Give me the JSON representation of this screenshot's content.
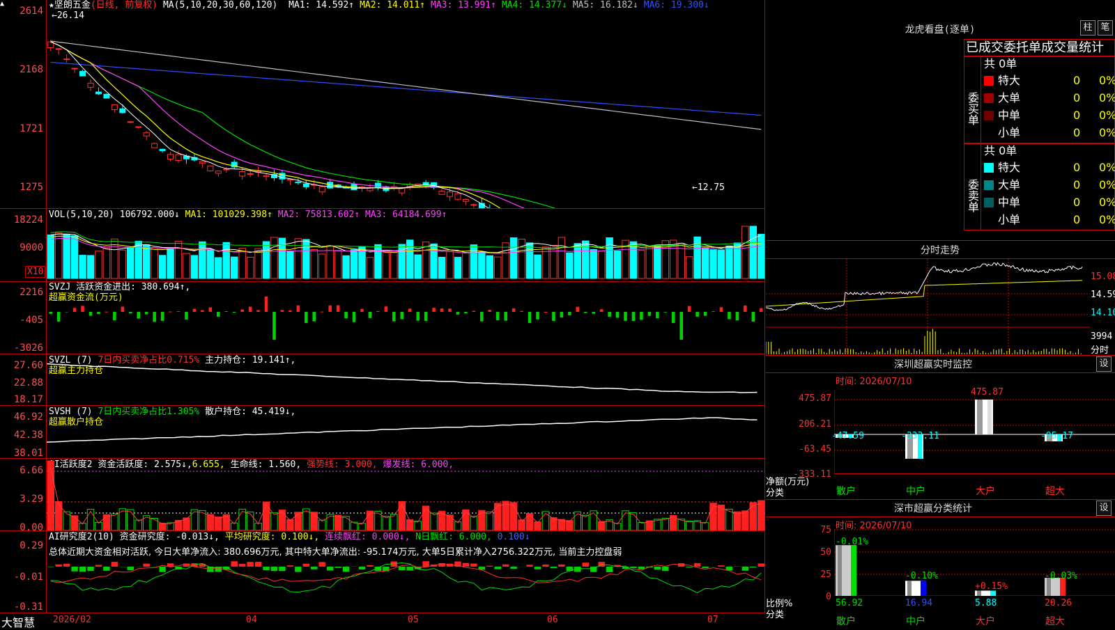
{
  "stock": {
    "name": "★坚朗五金",
    "mode": "(日线, 前复权)",
    "ma_label": "MA(5,10,20,30,60,120)",
    "ma": [
      {
        "k": "MA1:",
        "v": "14.592↑",
        "c": "#fff"
      },
      {
        "k": "MA2:",
        "v": "14.011↑",
        "c": "#ffff00"
      },
      {
        "k": "MA3:",
        "v": "13.991↑",
        "c": "#ff40ff"
      },
      {
        "k": "MA4:",
        "v": "14.377↓",
        "c": "#00e000"
      },
      {
        "k": "MA5:",
        "v": "16.182↓",
        "c": "#c0c0c0"
      },
      {
        "k": "MA6:",
        "v": "19.300↓",
        "c": "#3050ff"
      }
    ],
    "high_mark": "←26.14",
    "low_mark": "←12.75",
    "price_axis": [
      "2614",
      "2168",
      "1721",
      "1275"
    ]
  },
  "vol": {
    "label": "VOL(5,10,20)",
    "value": "106792.000↓",
    "ma1": "MA1: 101029.398↑",
    "ma2": "MA2: 75813.602↑",
    "ma3": "MA3: 64184.699↑",
    "axis": [
      "18224",
      "9000"
    ],
    "unit": "X10"
  },
  "svzj": {
    "label": "SVZJ",
    "line1": "活跃资金进出: 380.694↑,",
    "line2": "超赢资金流(万元)",
    "axis": [
      "2216",
      "-405",
      "-3026"
    ]
  },
  "svzl": {
    "label": "SVZL (7)",
    "pct": "7日内买卖净占比0.715%",
    "hold": "主力持仓: 19.141↑,",
    "line2": "超赢主力持仓",
    "axis": [
      "27.60",
      "22.88",
      "18.17"
    ]
  },
  "svsh": {
    "label": "SVSH (7)",
    "pct": "7日内买卖净占比1.305%",
    "hold": "散户持仓: 45.419↓,",
    "line2": "超赢散户持仓",
    "axis": [
      "46.92",
      "42.38",
      "38.01"
    ]
  },
  "ai2": {
    "label": "AI活跃度2",
    "t1": "资金活跃度: 2.575↓,",
    "t2": "6.655,",
    "t3": "生命线: 1.560,",
    "t4": "强势线: 3.000,",
    "t5": "爆发线: 6.000,",
    "axis": [
      "6.66",
      "3.29",
      "0.00"
    ]
  },
  "ai3": {
    "label": "AI研究度2(10)",
    "t1": "资金研究度: -0.013↓,",
    "t2": "平均研究度: 0.100↓,",
    "t3": "连续飘红: 0.000↓,",
    "t4": "N日飘红: 6.000,",
    "t5": "0.100↓",
    "summary": "总体近期大资金相对活跃, 今日大单净流入: 380.696万元, 其中特大单净流出: -95.174万元, 大单5日累计净入2756.322万元, 当前主力控盘弱",
    "axis": [
      "0.29",
      "-0.01",
      "-0.31"
    ]
  },
  "dates": [
    "2026/02",
    "04",
    "05",
    "06",
    "07"
  ],
  "brand": "大智慧",
  "lhb": {
    "title": "龙虎看盘(逐单)",
    "btn1": "柱",
    "btn2": "笔",
    "sub": "已成交委托单成交量统计",
    "buy": {
      "label": "委买单",
      "total": "共 0单",
      "rows": [
        {
          "n": "特大",
          "c": "#ff0000",
          "v": "0",
          "p": "0%"
        },
        {
          "n": "大单",
          "c": "#a00000",
          "v": "0",
          "p": "0%"
        },
        {
          "n": "中单",
          "c": "#700000",
          "v": "0",
          "p": "0%"
        },
        {
          "n": "小单",
          "c": "#000",
          "v": "0",
          "p": "0%"
        }
      ]
    },
    "sell": {
      "label": "委卖单",
      "total": "共 0单",
      "rows": [
        {
          "n": "特大",
          "c": "#00ffff",
          "v": "0",
          "p": "0%"
        },
        {
          "n": "大单",
          "c": "#008888",
          "v": "0",
          "p": "0%"
        },
        {
          "n": "中单",
          "c": "#006060",
          "v": "0",
          "p": "0%"
        },
        {
          "n": "小单",
          "c": "#000",
          "v": "0",
          "p": "0%"
        }
      ]
    }
  },
  "fs": {
    "title": "分时走势",
    "axis": [
      "15.08",
      "14.59",
      "14.10"
    ],
    "vol": "3994",
    "vol_unit": "分时"
  },
  "sz": {
    "title": "深圳超赢实时监控",
    "btn": "设",
    "time": "时间: 2026/07/10",
    "axis": [
      "475.87",
      "206.21",
      "-63.45",
      "-333.11"
    ],
    "side": "净额(万元)",
    "side2": "分类",
    "cats": [
      "散户",
      "中户",
      "大户",
      "超大"
    ],
    "vals": [
      "-47.59",
      "-333.11",
      "475.87",
      "-95.17"
    ]
  },
  "cls": {
    "title": "深市超赢分类统计",
    "btn": "设",
    "time": "时间: 2026/07/10",
    "axis": [
      "75",
      "50",
      "25",
      "0"
    ],
    "side": "比例%",
    "side2": "分类",
    "cats": [
      "散户",
      "中户",
      "大户",
      "超大"
    ],
    "pcts": [
      "-0.01%",
      "-0.10%",
      "+0.15%",
      "-0.03%"
    ],
    "vals": [
      "56.92",
      "16.94",
      "5.88",
      "20.26"
    ]
  }
}
